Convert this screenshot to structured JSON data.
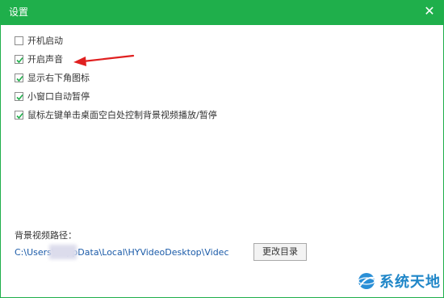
{
  "titlebar": {
    "title": "设置",
    "close_glyph": "✕"
  },
  "options": [
    {
      "label": "开机启动",
      "checked": false
    },
    {
      "label": "开启声音",
      "checked": true
    },
    {
      "label": "显示右下角图标",
      "checked": true
    },
    {
      "label": "小窗口自动暂停",
      "checked": true
    },
    {
      "label": "鼠标左键单击桌面空白处控制背景视频播放/暂停",
      "checked": true
    }
  ],
  "video_path": {
    "label": "背景视频路径：",
    "value": "C:\\Users\\        \\AppData\\Local\\HYVideoDesktop\\Videc",
    "change_button": "更改目录"
  },
  "watermark": {
    "text": "系统天地",
    "icon": "globe-logo-icon"
  },
  "annotation": {
    "icon": "red-arrow-icon",
    "color": "#e02020"
  },
  "colors": {
    "titlebar_bg": "#1faf4b",
    "checkbox_check": "#1faf4b",
    "path_text": "#1a5aa8"
  }
}
